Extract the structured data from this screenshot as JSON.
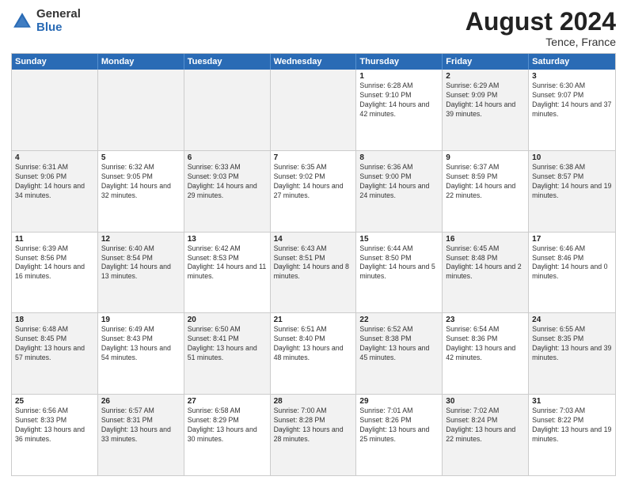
{
  "logo": {
    "general": "General",
    "blue": "Blue"
  },
  "title": {
    "month_year": "August 2024",
    "location": "Tence, France"
  },
  "header_days": [
    "Sunday",
    "Monday",
    "Tuesday",
    "Wednesday",
    "Thursday",
    "Friday",
    "Saturday"
  ],
  "weeks": [
    [
      {
        "day": "",
        "info": "",
        "shaded": true
      },
      {
        "day": "",
        "info": "",
        "shaded": true
      },
      {
        "day": "",
        "info": "",
        "shaded": true
      },
      {
        "day": "",
        "info": "",
        "shaded": true
      },
      {
        "day": "1",
        "info": "Sunrise: 6:28 AM\nSunset: 9:10 PM\nDaylight: 14 hours and 42 minutes."
      },
      {
        "day": "2",
        "info": "Sunrise: 6:29 AM\nSunset: 9:09 PM\nDaylight: 14 hours and 39 minutes.",
        "shaded": true
      },
      {
        "day": "3",
        "info": "Sunrise: 6:30 AM\nSunset: 9:07 PM\nDaylight: 14 hours and 37 minutes."
      }
    ],
    [
      {
        "day": "4",
        "info": "Sunrise: 6:31 AM\nSunset: 9:06 PM\nDaylight: 14 hours and 34 minutes.",
        "shaded": true
      },
      {
        "day": "5",
        "info": "Sunrise: 6:32 AM\nSunset: 9:05 PM\nDaylight: 14 hours and 32 minutes."
      },
      {
        "day": "6",
        "info": "Sunrise: 6:33 AM\nSunset: 9:03 PM\nDaylight: 14 hours and 29 minutes.",
        "shaded": true
      },
      {
        "day": "7",
        "info": "Sunrise: 6:35 AM\nSunset: 9:02 PM\nDaylight: 14 hours and 27 minutes."
      },
      {
        "day": "8",
        "info": "Sunrise: 6:36 AM\nSunset: 9:00 PM\nDaylight: 14 hours and 24 minutes.",
        "shaded": true
      },
      {
        "day": "9",
        "info": "Sunrise: 6:37 AM\nSunset: 8:59 PM\nDaylight: 14 hours and 22 minutes."
      },
      {
        "day": "10",
        "info": "Sunrise: 6:38 AM\nSunset: 8:57 PM\nDaylight: 14 hours and 19 minutes.",
        "shaded": true
      }
    ],
    [
      {
        "day": "11",
        "info": "Sunrise: 6:39 AM\nSunset: 8:56 PM\nDaylight: 14 hours and 16 minutes."
      },
      {
        "day": "12",
        "info": "Sunrise: 6:40 AM\nSunset: 8:54 PM\nDaylight: 14 hours and 13 minutes.",
        "shaded": true
      },
      {
        "day": "13",
        "info": "Sunrise: 6:42 AM\nSunset: 8:53 PM\nDaylight: 14 hours and 11 minutes."
      },
      {
        "day": "14",
        "info": "Sunrise: 6:43 AM\nSunset: 8:51 PM\nDaylight: 14 hours and 8 minutes.",
        "shaded": true
      },
      {
        "day": "15",
        "info": "Sunrise: 6:44 AM\nSunset: 8:50 PM\nDaylight: 14 hours and 5 minutes."
      },
      {
        "day": "16",
        "info": "Sunrise: 6:45 AM\nSunset: 8:48 PM\nDaylight: 14 hours and 2 minutes.",
        "shaded": true
      },
      {
        "day": "17",
        "info": "Sunrise: 6:46 AM\nSunset: 8:46 PM\nDaylight: 14 hours and 0 minutes."
      }
    ],
    [
      {
        "day": "18",
        "info": "Sunrise: 6:48 AM\nSunset: 8:45 PM\nDaylight: 13 hours and 57 minutes.",
        "shaded": true
      },
      {
        "day": "19",
        "info": "Sunrise: 6:49 AM\nSunset: 8:43 PM\nDaylight: 13 hours and 54 minutes."
      },
      {
        "day": "20",
        "info": "Sunrise: 6:50 AM\nSunset: 8:41 PM\nDaylight: 13 hours and 51 minutes.",
        "shaded": true
      },
      {
        "day": "21",
        "info": "Sunrise: 6:51 AM\nSunset: 8:40 PM\nDaylight: 13 hours and 48 minutes."
      },
      {
        "day": "22",
        "info": "Sunrise: 6:52 AM\nSunset: 8:38 PM\nDaylight: 13 hours and 45 minutes.",
        "shaded": true
      },
      {
        "day": "23",
        "info": "Sunrise: 6:54 AM\nSunset: 8:36 PM\nDaylight: 13 hours and 42 minutes."
      },
      {
        "day": "24",
        "info": "Sunrise: 6:55 AM\nSunset: 8:35 PM\nDaylight: 13 hours and 39 minutes.",
        "shaded": true
      }
    ],
    [
      {
        "day": "25",
        "info": "Sunrise: 6:56 AM\nSunset: 8:33 PM\nDaylight: 13 hours and 36 minutes."
      },
      {
        "day": "26",
        "info": "Sunrise: 6:57 AM\nSunset: 8:31 PM\nDaylight: 13 hours and 33 minutes.",
        "shaded": true
      },
      {
        "day": "27",
        "info": "Sunrise: 6:58 AM\nSunset: 8:29 PM\nDaylight: 13 hours and 30 minutes."
      },
      {
        "day": "28",
        "info": "Sunrise: 7:00 AM\nSunset: 8:28 PM\nDaylight: 13 hours and 28 minutes.",
        "shaded": true
      },
      {
        "day": "29",
        "info": "Sunrise: 7:01 AM\nSunset: 8:26 PM\nDaylight: 13 hours and 25 minutes."
      },
      {
        "day": "30",
        "info": "Sunrise: 7:02 AM\nSunset: 8:24 PM\nDaylight: 13 hours and 22 minutes.",
        "shaded": true
      },
      {
        "day": "31",
        "info": "Sunrise: 7:03 AM\nSunset: 8:22 PM\nDaylight: 13 hours and 19 minutes."
      }
    ]
  ]
}
